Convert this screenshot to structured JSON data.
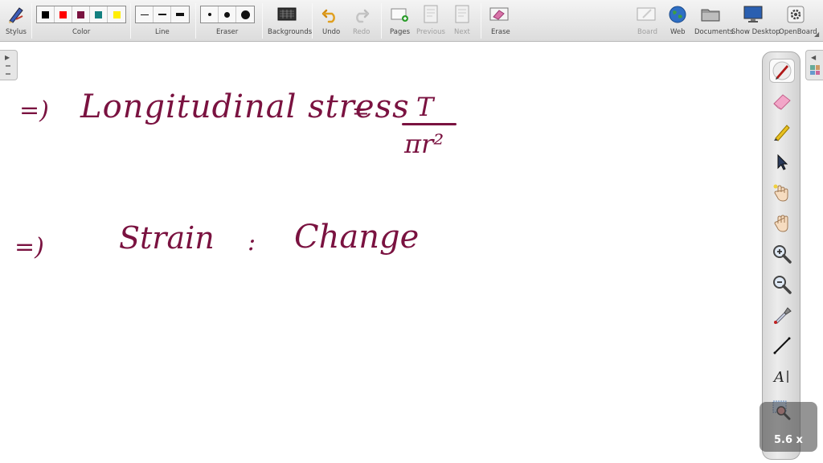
{
  "toolbar": {
    "stylus": "Stylus",
    "color": "Color",
    "line": "Line",
    "eraser": "Eraser",
    "backgrounds": "Backgrounds",
    "undo": "Undo",
    "redo": "Redo",
    "pages": "Pages",
    "previous": "Previous",
    "next": "Next",
    "erase": "Erase",
    "board": "Board",
    "web": "Web",
    "documents": "Documents",
    "show_desktop": "Show Desktop",
    "openboard": "OpenBoard"
  },
  "colors": {
    "swatches": [
      "#000000",
      "#ff0000",
      "#7a1240",
      "#138080",
      "#ffee00"
    ],
    "ink": "#7a1240"
  },
  "icons": {
    "palette": [
      "pen-icon",
      "eraser-icon",
      "highlighter-icon",
      "pointer-icon",
      "laser-hand-icon",
      "hand-icon",
      "zoom-in-icon",
      "zoom-out-icon",
      "pipette-icon",
      "line-icon",
      "text-icon",
      "capture-icon"
    ]
  },
  "board": {
    "line1_arrow": "=)",
    "line1_text": "Longitudinal stress",
    "line1_equals": "=",
    "fraction_numerator": "T",
    "fraction_denominator": "πr²",
    "line2_arrow": "=)",
    "line2_text": "Strain",
    "line2_colon": ":",
    "line2_value": "Change"
  },
  "zoom": {
    "label": "5.6 x"
  }
}
